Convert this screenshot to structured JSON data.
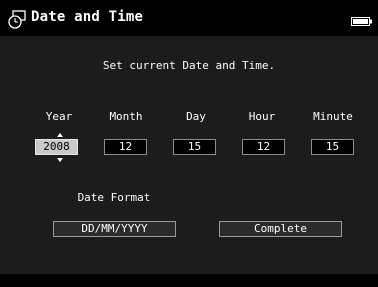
{
  "header": {
    "title": "Date and Time",
    "icon": "clock-icon",
    "status_icon": "battery-icon"
  },
  "instruction": "Set current Date and Time.",
  "fields": [
    {
      "label": "Year",
      "value": "2008",
      "selected": true
    },
    {
      "label": "Month",
      "value": "12",
      "selected": false
    },
    {
      "label": "Day",
      "value": "15",
      "selected": false
    },
    {
      "label": "Hour",
      "value": "12",
      "selected": false
    },
    {
      "label": "Minute",
      "value": "15",
      "selected": false
    }
  ],
  "date_format": {
    "label": "Date Format",
    "value": "DD/MM/YYYY"
  },
  "complete_button": {
    "label": "Complete"
  },
  "colors": {
    "selected_field_bg": "#c9c9c9",
    "panel_bg": "#1c1c1c",
    "bar_bg": "#000000"
  }
}
